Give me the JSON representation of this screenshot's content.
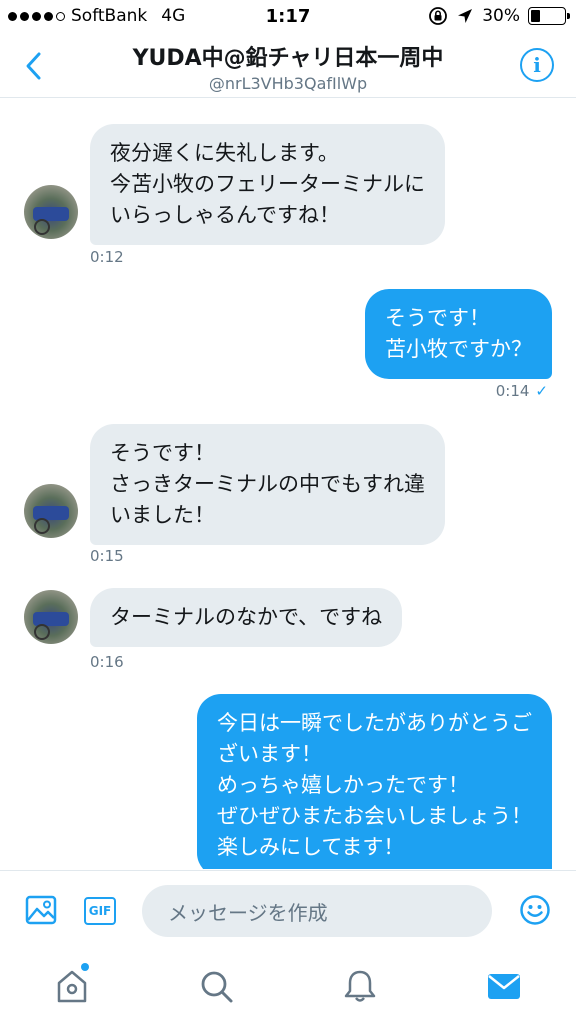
{
  "status_bar": {
    "carrier": "SoftBank",
    "network": "4G",
    "time": "1:17",
    "battery": "30%",
    "battery_level": 0.3
  },
  "header": {
    "name": "YUDA中@鉛チャリ日本一周中",
    "handle": "@nrL3VHb3QafIlWp"
  },
  "messages": [
    {
      "direction": "in",
      "lines": [
        "夜分遅くに失礼します。",
        "今苫小牧のフェリーターミナルに",
        "いらっしゃるんですね！"
      ],
      "time": "0:12"
    },
    {
      "direction": "out",
      "lines": [
        "そうです！",
        "苫小牧ですか？"
      ],
      "time": "0:14",
      "read_mark": "✓"
    },
    {
      "direction": "in",
      "lines": [
        "そうです！",
        "さっきターミナルの中でもすれ違",
        "いました！"
      ],
      "time": "0:15"
    },
    {
      "direction": "in",
      "lines": [
        "ターミナルのなかで、ですね"
      ],
      "time": "0:16"
    },
    {
      "direction": "out",
      "lines": [
        "今日は一瞬でしたがありがとうご",
        "ざいます！",
        "めっちゃ嬉しかったです！",
        "ぜひぜひまたお会いしましょう！",
        "楽しみにしてます！"
      ]
    }
  ],
  "composer": {
    "gif_label": "GIF",
    "placeholder": "メッセージを作成"
  },
  "icons": {
    "back": "chevron-left-icon",
    "info": "info-icon",
    "image": "image-icon",
    "gif": "gif-icon",
    "emoji": "emoji-icon",
    "home": "home-icon",
    "search": "search-icon",
    "notifications": "bell-icon",
    "messages": "mail-icon"
  },
  "colors": {
    "accent": "#1da1f2",
    "incoming_bubble": "#e6ecf0",
    "meta_text": "#657786"
  }
}
